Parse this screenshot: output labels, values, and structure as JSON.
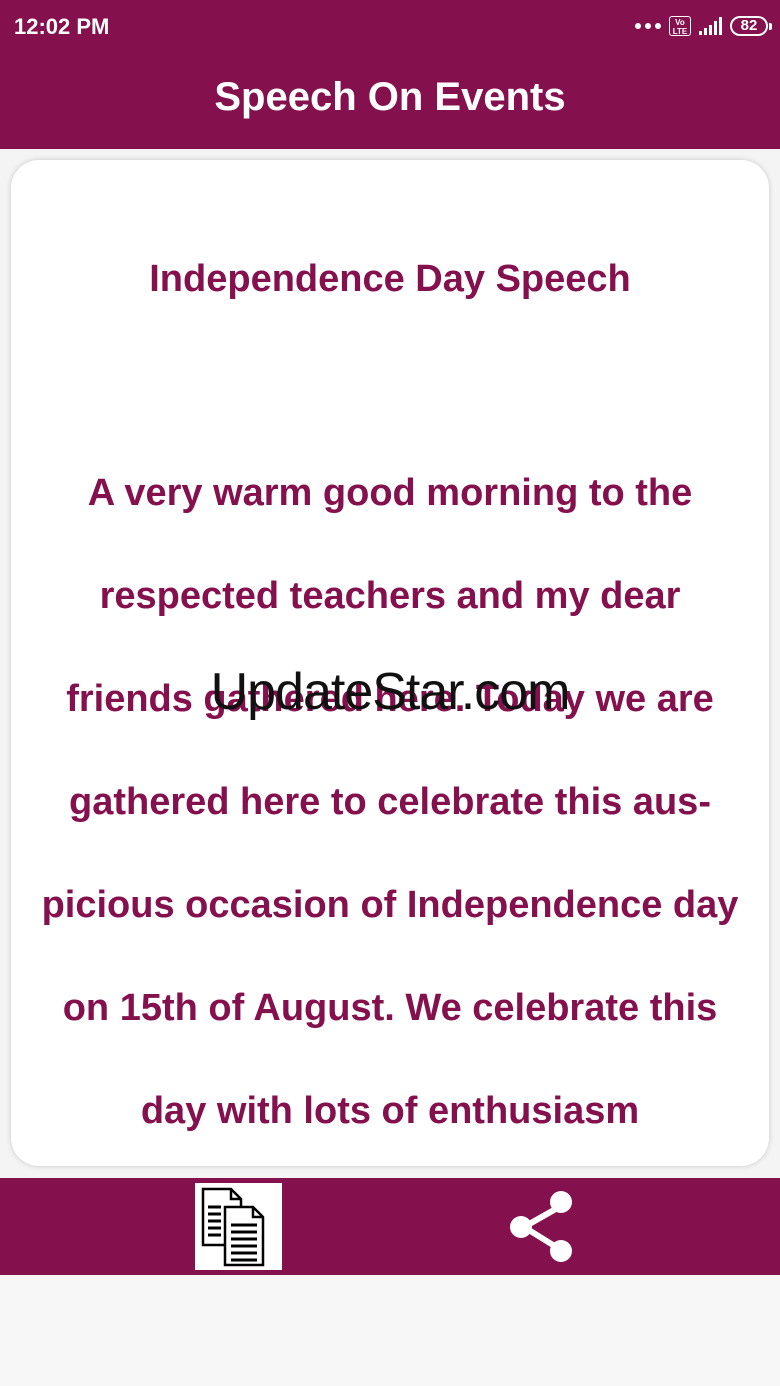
{
  "status_bar": {
    "time": "12:02 PM",
    "volte_label": "Vo LTE",
    "battery_level": "82"
  },
  "app_bar": {
    "title": "Speech On Events"
  },
  "speech": {
    "title": "Independence Day Speech",
    "body": "A very warm good morning to the respected teachers and my dear friends gathered here. Today we are gathered here to celebrate this aus- picious occasion of Independence day on 15th of August. We celebrate this day with lots of enthusiasm"
  },
  "watermark": "UpdateStar.com",
  "bottom_bar": {
    "copy_icon": "copy-documents-icon",
    "share_icon": "share-icon"
  },
  "colors": {
    "primary": "#84104d",
    "card_background": "#ffffff",
    "page_background": "#f4f4f4"
  }
}
